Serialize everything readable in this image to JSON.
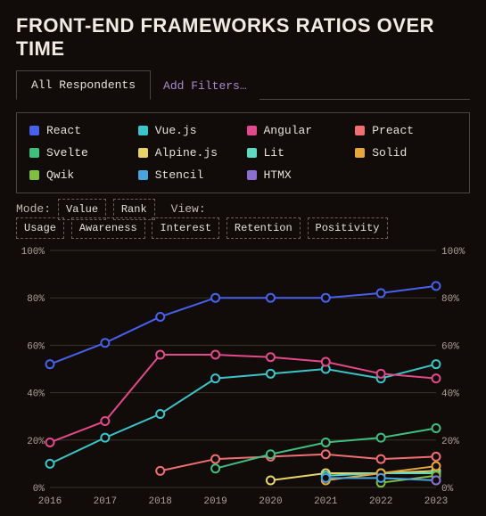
{
  "title": "FRONT-END FRAMEWORKS RATIOS OVER TIME",
  "tabs": {
    "active": "All Respondents",
    "add": "Add Filters…"
  },
  "legend": [
    {
      "name": "React",
      "color": "#4861ec"
    },
    {
      "name": "Vue.js",
      "color": "#3bc5c9"
    },
    {
      "name": "Angular",
      "color": "#e24a8b"
    },
    {
      "name": "Preact",
      "color": "#ef6f72"
    },
    {
      "name": "Svelte",
      "color": "#3fbf7f"
    },
    {
      "name": "Alpine.js",
      "color": "#e8d36a"
    },
    {
      "name": "Lit",
      "color": "#5fd9bf"
    },
    {
      "name": "Solid",
      "color": "#e6a83c"
    },
    {
      "name": "Qwik",
      "color": "#7fbf3f"
    },
    {
      "name": "Stencil",
      "color": "#4aa3e0"
    },
    {
      "name": "HTMX",
      "color": "#8a6fd0"
    }
  ],
  "controls": {
    "mode_label": "Mode:",
    "mode": [
      "Value",
      "Rank"
    ],
    "view_label": "View:",
    "view": [
      "Usage",
      "Awareness",
      "Interest",
      "Retention",
      "Positivity"
    ]
  },
  "chart_data": {
    "type": "line",
    "xlabel": "",
    "ylabel": "",
    "ylim": [
      0,
      100
    ],
    "yticks": [
      0,
      20,
      40,
      60,
      80,
      100
    ],
    "ytick_suffix": "%",
    "categories": [
      "2016",
      "2017",
      "2018",
      "2019",
      "2020",
      "2021",
      "2022",
      "2023"
    ],
    "series": [
      {
        "name": "React",
        "color": "#4861ec",
        "values": [
          52,
          61,
          72,
          80,
          80,
          80,
          82,
          85
        ]
      },
      {
        "name": "Vue.js",
        "color": "#3bc5c9",
        "values": [
          10,
          21,
          31,
          46,
          48,
          50,
          46,
          52
        ]
      },
      {
        "name": "Angular",
        "color": "#e24a8b",
        "values": [
          19,
          28,
          56,
          56,
          55,
          53,
          48,
          46
        ]
      },
      {
        "name": "Preact",
        "color": "#ef6f72",
        "values": [
          null,
          null,
          7,
          12,
          13,
          14,
          12,
          13
        ]
      },
      {
        "name": "Svelte",
        "color": "#3fbf7f",
        "values": [
          null,
          null,
          null,
          8,
          14,
          19,
          21,
          25
        ]
      },
      {
        "name": "Alpine.js",
        "color": "#e8d36a",
        "values": [
          null,
          null,
          null,
          null,
          3,
          6,
          6,
          7
        ]
      },
      {
        "name": "Lit",
        "color": "#5fd9bf",
        "values": [
          null,
          null,
          null,
          null,
          null,
          5,
          6,
          6
        ]
      },
      {
        "name": "Solid",
        "color": "#e6a83c",
        "values": [
          null,
          null,
          null,
          null,
          null,
          3,
          6,
          9
        ]
      },
      {
        "name": "Qwik",
        "color": "#7fbf3f",
        "values": [
          null,
          null,
          null,
          null,
          null,
          null,
          2,
          5
        ]
      },
      {
        "name": "Stencil",
        "color": "#4aa3e0",
        "values": [
          null,
          null,
          null,
          null,
          null,
          4,
          4,
          3
        ]
      },
      {
        "name": "HTMX",
        "color": "#8a6fd0",
        "values": [
          null,
          null,
          null,
          null,
          null,
          null,
          null,
          3
        ]
      }
    ]
  }
}
